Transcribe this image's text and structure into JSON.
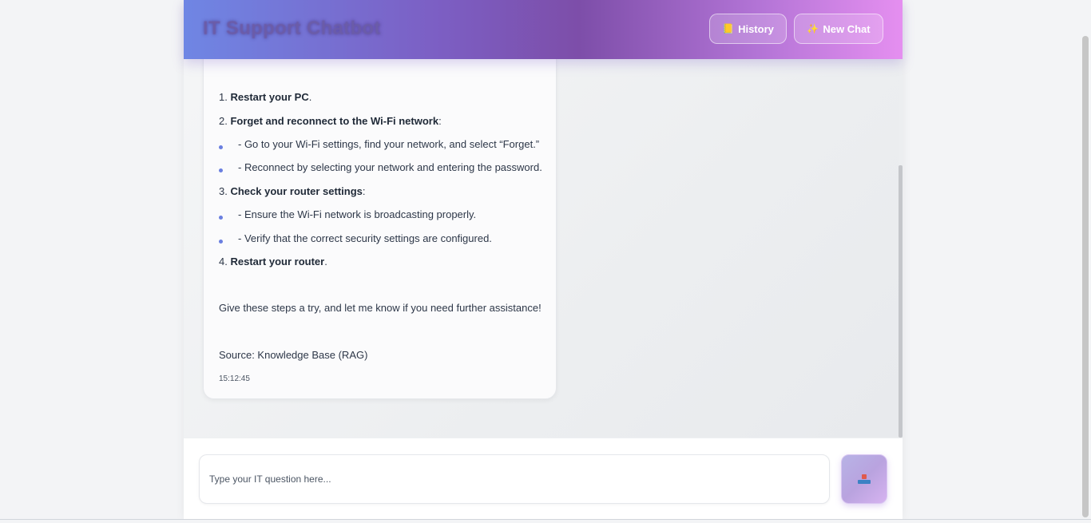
{
  "header": {
    "title": "IT Support Chatbot",
    "history_icon": "book-icon",
    "history_label": "History",
    "newchat_icon": "sparkles-icon",
    "newchat_label": "New Chat"
  },
  "message": {
    "steps": [
      {
        "num": "1.",
        "bold": "Restart your PC",
        "rest": "."
      },
      {
        "num": "2.",
        "bold": "Forget and reconnect to the Wi-Fi network",
        "rest": ":"
      },
      {
        "num": "3.",
        "bold": "Check your router settings",
        "rest": ":"
      },
      {
        "num": "4.",
        "bold": "Restart your router",
        "rest": "."
      }
    ],
    "substeps": [
      "- Go to your Wi-Fi settings, find your network, and select “Forget.”",
      "- Reconnect by selecting your network and entering the password.",
      "- Ensure the Wi-Fi network is broadcasting properly.",
      "- Verify that the correct security settings are configured."
    ],
    "closing": "Give these steps a try, and let me know if you need further assistance!",
    "source": "Source: Knowledge Base (RAG)",
    "timestamp": "15:12:45"
  },
  "composer": {
    "placeholder": "Type your IT question here...",
    "value": "",
    "send_icon": "outbox-tray-icon"
  },
  "colors": {
    "header_gradient_start": "#6f86e4",
    "header_gradient_mid": "#7d4ea9",
    "header_gradient_end": "#e58ff0",
    "bullet": "#6a7fe0"
  }
}
